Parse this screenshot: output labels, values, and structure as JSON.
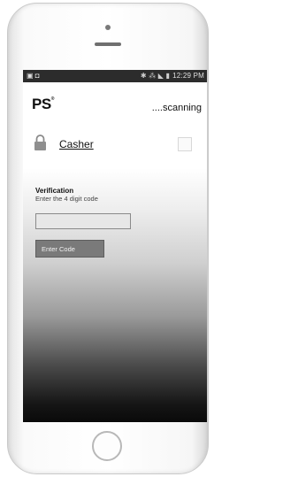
{
  "statusbar": {
    "left_icons": "▣ ◘",
    "right_icons": "✱ ⁂ ◣ ▮",
    "time": "12:29 PM"
  },
  "app": {
    "logo": "PS",
    "logo_mark": "®",
    "scan_status": "....scanning"
  },
  "device": {
    "name": "Casher",
    "icon": "lock-icon"
  },
  "verification": {
    "title": "Verification",
    "hint": "Enter the 4 digit code",
    "input_value": "",
    "button_label": "Enter Code"
  },
  "colors": {
    "statusbar": "#2c2c2c",
    "button": "#7a7a7a"
  }
}
